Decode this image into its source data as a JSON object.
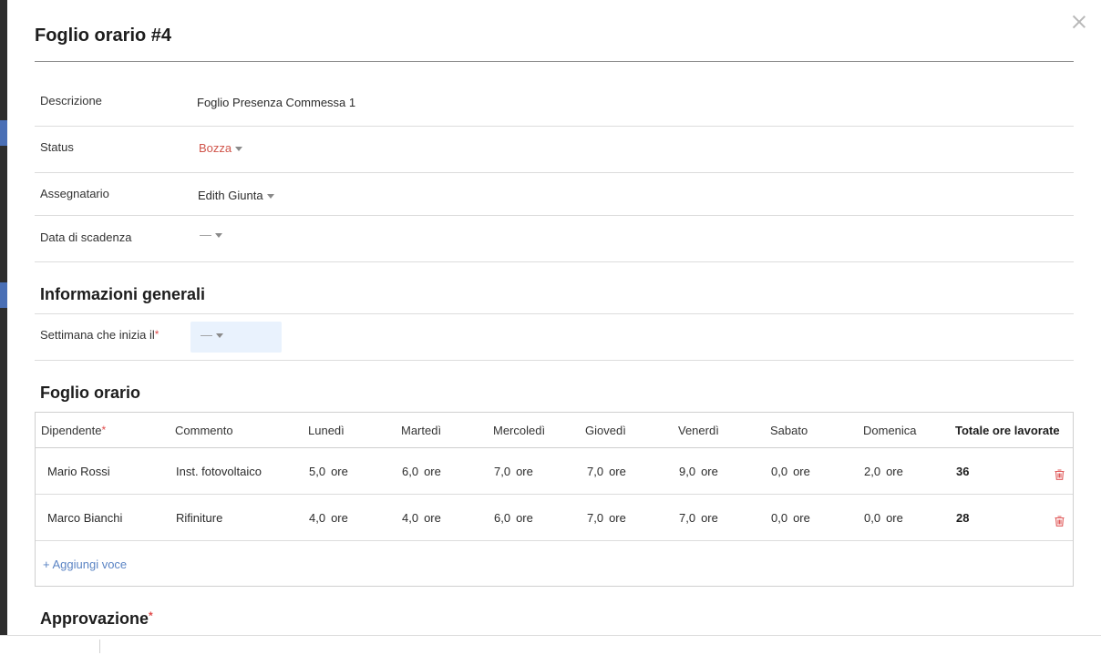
{
  "modal": {
    "title": "Foglio orario #4"
  },
  "fields": {
    "description": {
      "label": "Descrizione",
      "value": "Foglio Presenza Commessa 1"
    },
    "status": {
      "label": "Status",
      "value": "Bozza"
    },
    "assignee": {
      "label": "Assegnatario",
      "value": "Edith Giunta"
    },
    "due_date": {
      "label": "Data di scadenza",
      "value": "—"
    }
  },
  "general_info": {
    "title": "Informazioni generali",
    "week_label": "Settimana che inizia il",
    "required_mark": "*",
    "week_value": "—"
  },
  "timesheet": {
    "title": "Foglio orario",
    "columns": [
      "Dipendente",
      "Commento",
      "Lunedì",
      "Martedì",
      "Mercoledì",
      "Giovedì",
      "Venerdì",
      "Sabato",
      "Domenica",
      "Totale ore lavorate"
    ],
    "required_mark": "*",
    "unit": "ore",
    "rows": [
      {
        "employee": "Mario Rossi",
        "comment": "Inst. fotovoltaico",
        "hours": [
          "5,0",
          "6,0",
          "7,0",
          "7,0",
          "9,0",
          "0,0",
          "2,0"
        ],
        "total": "36"
      },
      {
        "employee": "Marco Bianchi",
        "comment": "Rifiniture",
        "hours": [
          "4,0",
          "4,0",
          "6,0",
          "7,0",
          "7,0",
          "0,0",
          "0,0"
        ],
        "total": "28"
      }
    ],
    "add_label": "+ Aggiungi voce"
  },
  "approval": {
    "title": "Approvazione",
    "required_mark": "*"
  },
  "colors": {
    "accent": "#5b84c4",
    "status": "#d0544a",
    "danger": "#e05a5a",
    "input_bg": "#e9f2fd"
  },
  "icons": {
    "close": "close-icon",
    "trash": "trash-icon",
    "dropdown": "caret-down-icon"
  }
}
